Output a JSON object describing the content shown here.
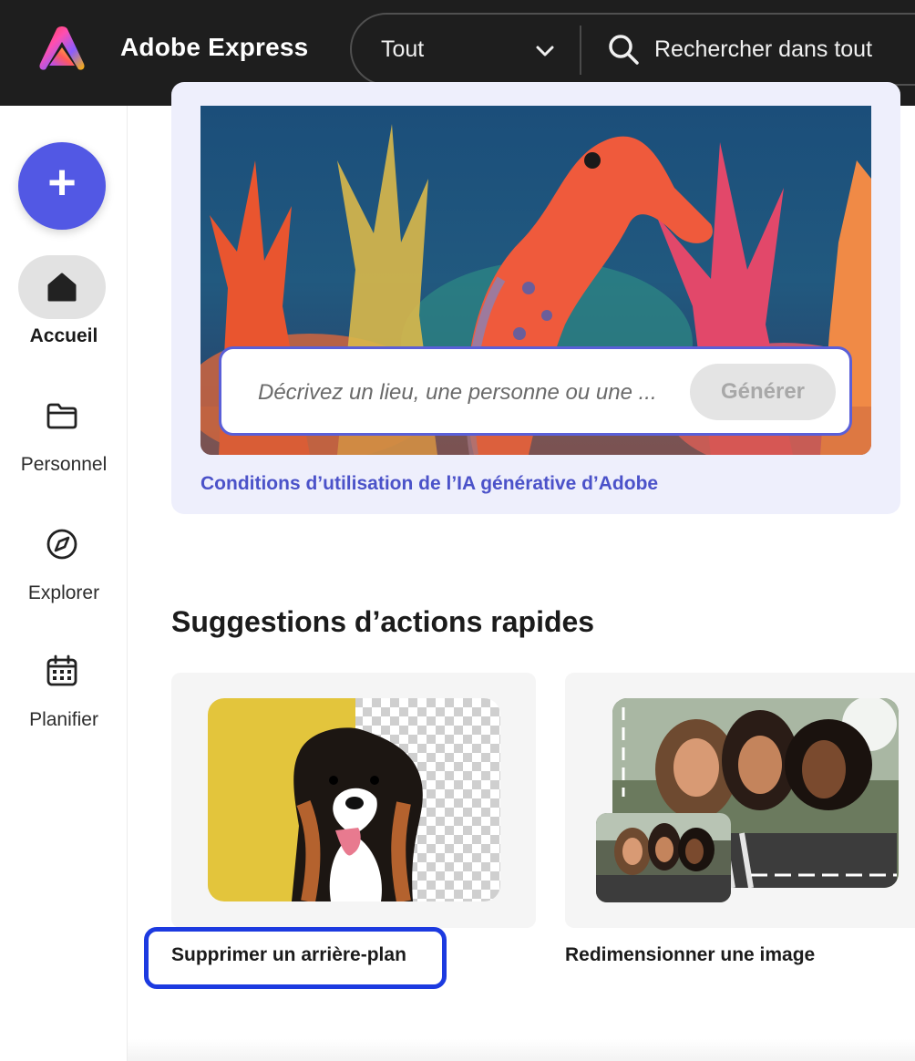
{
  "header": {
    "app_title": "Adobe Express",
    "logo_icon": "adobe-express-logo-icon",
    "search": {
      "scope_value": "Tout",
      "placeholder": "Rechercher dans tout"
    }
  },
  "sidebar": {
    "create_icon": "plus-icon",
    "items": [
      {
        "label": "Accueil",
        "icon": "home-icon",
        "active": true
      },
      {
        "label": "Personnel",
        "icon": "folder-icon",
        "active": false
      },
      {
        "label": "Explorer",
        "icon": "compass-icon",
        "active": false
      },
      {
        "label": "Planifier",
        "icon": "calendar-icon",
        "active": false
      }
    ]
  },
  "generate": {
    "prompt_placeholder": "Décrivez un lieu, une personne ou une ...",
    "button_label": "Générer",
    "terms_link": "Conditions d’utilisation de l’IA générative d’Adobe"
  },
  "quick_actions": {
    "title": "Suggestions d’actions rapides",
    "items": [
      {
        "label": "Supprimer un arrière-plan"
      },
      {
        "label": "Redimensionner une image"
      }
    ]
  },
  "colors": {
    "topbar": "#1e1e1e",
    "accent": "#5258e4",
    "link": "#4b52c9",
    "focus_ring": "#1c3ae0",
    "card_bg": "#eeeffc"
  }
}
